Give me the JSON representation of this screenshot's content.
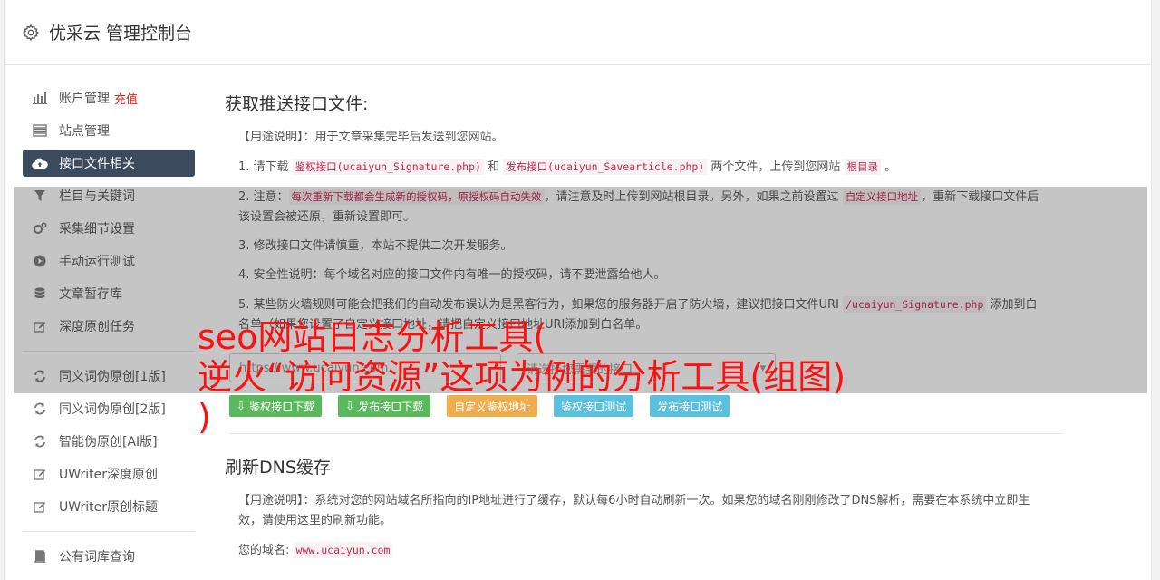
{
  "header": {
    "title": "优采云 管理控制台",
    "icon": "gear-icon"
  },
  "sidebar": {
    "group1": [
      {
        "label": "账户管理",
        "badge": "充值",
        "icon": "bar-chart-icon"
      },
      {
        "label": "站点管理",
        "icon": "server-icon"
      },
      {
        "label": "接口文件相关",
        "icon": "cloud-upload-icon",
        "active": true
      },
      {
        "label": "栏目与关键词",
        "icon": "filter-icon"
      },
      {
        "label": "采集细节设置",
        "icon": "cogs-icon"
      },
      {
        "label": "手动运行测试",
        "icon": "play-circle-icon"
      },
      {
        "label": "文章暂存库",
        "icon": "database-icon"
      },
      {
        "label": "深度原创任务",
        "icon": "edit-icon"
      }
    ],
    "group2": [
      {
        "label": "同义词伪原创[1版]",
        "icon": "refresh-icon"
      },
      {
        "label": "同义词伪原创[2版]",
        "icon": "refresh-icon"
      },
      {
        "label": "智能伪原创[AI版]",
        "icon": "refresh-icon"
      },
      {
        "label": "UWriter深度原创",
        "icon": "edit-icon"
      },
      {
        "label": "UWriter原创标题",
        "icon": "edit-icon"
      }
    ],
    "group3": [
      {
        "label": "公有词库查询",
        "icon": "book-icon"
      }
    ]
  },
  "section1": {
    "title": "获取推送接口文件:",
    "usage": "【用途说明】：用于文章采集完毕后发送到您网站。",
    "p1_a": "1. 请下载 ",
    "p1_code1": "鉴权接口(ucaiyun_Signature.php)",
    "p1_b": " 和 ",
    "p1_code2": "发布接口(ucaiyun_Savearticle.php)",
    "p1_c": " 两个文件，上传到您网站 ",
    "p1_code3": "根目录",
    "p1_d": " 。",
    "p2_a": "2. 注意：",
    "p2_code1": "每次重新下载都会生成新的授权码，原授权码自动失效",
    "p2_b": "，请注意及时上传到网站根目录。另外，如果之前设置过 ",
    "p2_code2": "自定义接口地址",
    "p2_c": "，重新下载接口文件后该设置会被还原，重新设置即可。",
    "p3": "3. 修改接口文件请慎重，本站不提供二次开发服务。",
    "p4": "4. 安全性说明：每个域名对应的接口文件内有唯一的授权码，请不要泄露给他人。",
    "p5_a": "5. 某些防火墙规则可能会把我们的自动发布误认为是黑客行为，如果您的服务器开启了防火墙，建议把接口文件URI ",
    "p5_code": "/ucaiyun_Signature.php",
    "p5_b": " 添加到白名单（如果您设置了自定义接口地址，请把自定义接口地址URI添加到白名单。",
    "url_placeholder": "https://www.ucaiyun.com",
    "select_placeholder": "请选择您需要的接口",
    "buttons": [
      "鉴权接口下载",
      "发布接口下载",
      "自定义鉴权地址",
      "鉴权接口测试",
      "发布接口测试"
    ]
  },
  "section2": {
    "title": "刷新DNS缓存",
    "usage": "【用途说明】：系统对您的网站域名所指向的IP地址进行了缓存，默认每6小时自动刷新一次。如果您的域名刚刚修改了DNS解析，需要在本系统中立即生效，请使用这里的刷新功能。",
    "domain_label": "您的域名:",
    "domain_value": "www.ucaiyun.com"
  },
  "overlay": {
    "line1": "seo网站日志分析工具(",
    "line2": "逆火“访问资源”这项为例的分析工具(组图)",
    "line3": ")"
  },
  "colors": {
    "active_nav": "#3c4a5e",
    "code_text": "#c7254e",
    "overlay_text": "#ff1010"
  }
}
